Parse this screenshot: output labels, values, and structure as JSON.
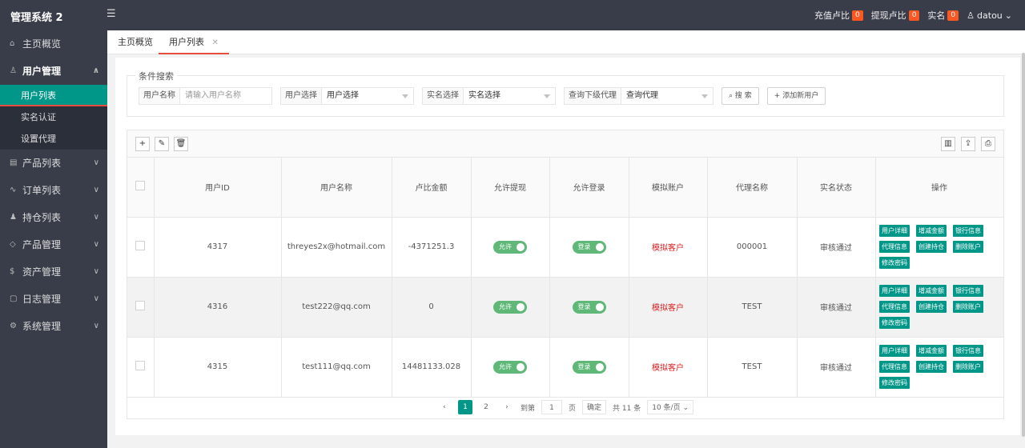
{
  "app": {
    "title": "管理系统 2",
    "menu_icon": "menu-icon"
  },
  "topbar": {
    "items": [
      {
        "label": "充值卢比",
        "badge": "0"
      },
      {
        "label": "提现卢比",
        "badge": "0"
      },
      {
        "label": "实名",
        "badge": "0"
      }
    ],
    "user": "datou"
  },
  "sidebar": {
    "items": [
      {
        "label": "主页概览",
        "icon": "home-icon"
      },
      {
        "label": "用户管理",
        "icon": "user-icon",
        "expanded": true
      },
      {
        "label": "产品列表",
        "icon": "product-icon"
      },
      {
        "label": "订单列表",
        "icon": "order-icon"
      },
      {
        "label": "持仓列表",
        "icon": "group-icon"
      },
      {
        "label": "产品管理",
        "icon": "diamond-icon"
      },
      {
        "label": "资产管理",
        "icon": "dollar-icon"
      },
      {
        "label": "日志管理",
        "icon": "log-icon"
      },
      {
        "label": "系统管理",
        "icon": "gear-icon"
      }
    ],
    "sub_items": [
      "用户列表",
      "实名认证",
      "设置代理"
    ]
  },
  "tabs": [
    {
      "label": "主页概览"
    },
    {
      "label": "用户列表",
      "active": true
    }
  ],
  "search": {
    "legend": "条件搜索",
    "username_label": "用户名称",
    "username_placeholder": "请输入用户名称",
    "user_select_label": "用户选择",
    "user_select_value": "用户选择",
    "realname_label": "实名选择",
    "realname_value": "实名选择",
    "agent_label": "查询下级代理",
    "agent_value": "查询代理",
    "search_button": "搜 索",
    "add_button": "添加新用户"
  },
  "table": {
    "headers": [
      "用户ID",
      "用户名称",
      "卢比金额",
      "允许提现",
      "允许登录",
      "模拟账户",
      "代理名称",
      "实名状态",
      "操作"
    ],
    "rows": [
      {
        "id": "4317",
        "name": "threyes2x@hotmail.com",
        "amount": "-4371251.3",
        "withdraw": "允许",
        "login": "登录",
        "sim": "模拟客户",
        "agent": "000001",
        "status": "审核通过"
      },
      {
        "id": "4316",
        "name": "test222@qq.com",
        "amount": "0",
        "withdraw": "允许",
        "login": "登录",
        "sim": "模拟客户",
        "agent": "TEST",
        "status": "审核通过"
      },
      {
        "id": "4315",
        "name": "test111@qq.com",
        "amount": "14481133.028",
        "withdraw": "允许",
        "login": "登录",
        "sim": "模拟客户",
        "agent": "TEST",
        "status": "审核通过"
      }
    ],
    "ops": [
      "用户详细",
      "增减金额",
      "银行信息",
      "代理信息",
      "创建持仓",
      "删除账户",
      "修改密码"
    ]
  },
  "pager": {
    "pages": [
      "1",
      "2"
    ],
    "goto_label": "到第",
    "goto_value": "1",
    "page_unit": "页",
    "confirm": "确定",
    "total": "共 11 条",
    "per_page": "10 条/页"
  },
  "colors": {
    "sidebar_bg": "#393d49",
    "accent": "#009688",
    "switch_on": "#5fb878",
    "badge": "#ff5722",
    "danger": "#e02020"
  }
}
